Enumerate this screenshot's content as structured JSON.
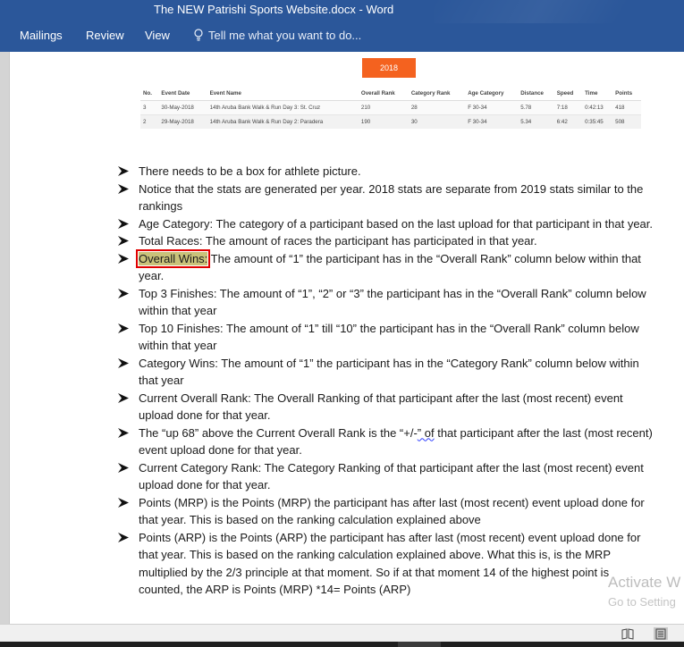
{
  "window": {
    "title": "The NEW Patrishi Sports Website.docx - Word"
  },
  "ribbon": {
    "tabs": [
      "Mailings",
      "Review",
      "View"
    ],
    "tell_me": "Tell me what you want to do..."
  },
  "document": {
    "year_badge": "2018",
    "table": {
      "headers": [
        "No.",
        "Event Date",
        "Event Name",
        "Overall Rank",
        "Category Rank",
        "Age Category",
        "Distance",
        "Speed",
        "Time",
        "Points"
      ],
      "rows": [
        [
          "3",
          "30-May-2018",
          "14th Aruba Bank Walk & Run Day 3: St. Cruz",
          "210",
          "28",
          "F 30-34",
          "5.78",
          "7:18",
          "0:42:13",
          "418"
        ],
        [
          "2",
          "29-May-2018",
          "14th Aruba Bank Walk & Run Day 2: Paradera",
          "190",
          "30",
          "F 30-34",
          "5.34",
          "6:42",
          "0:35:45",
          "508"
        ]
      ]
    },
    "bullets": [
      {
        "text": "There needs to be a box for athlete picture."
      },
      {
        "text": "Notice that the stats are generated per year. 2018 stats are separate from 2019 stats similar to the rankings"
      },
      {
        "text": "Age Category: The category of a participant based on the last upload for that participant in that year."
      },
      {
        "text": "Total Races: The amount of races the participant has participated in that year."
      },
      {
        "label": "Overall Wins:",
        "text": " The amount of “1” the participant has in the “Overall Rank” column below within that year."
      },
      {
        "text": "Top 3 Finishes: The amount of “1”, “2” or “3” the participant has in the “Overall Rank” column below within that year"
      },
      {
        "text": "Top 10 Finishes: The amount of “1” till “10” the participant has in the “Overall Rank” column below within that year"
      },
      {
        "text": "Category Wins: The amount of “1” the participant has in the “Category Rank” column below within that year"
      },
      {
        "text": "Current Overall Rank: The Overall Ranking of that participant after the last (most recent) event upload done for that year."
      },
      {
        "before": "The “up 68” above the Current Overall Rank is the “+/-",
        "wavy": "” of",
        "after": " that participant after the last (most recent) event upload done for that year."
      },
      {
        "text": "Current Category Rank: The Category Ranking of that participant after the last (most recent) event upload done for that year."
      },
      {
        "text": "Points (MRP) is the Points (MRP) the participant has after last (most recent) event upload done for that year. This is based on the ranking calculation explained above"
      },
      {
        "text": "Points (ARP) is the Points (ARP) the participant has after last (most recent) event upload done for that year. This is based on the ranking calculation explained above. What this is, is the MRP multiplied by the 2/3 principle at that moment. So if at that moment 14 of the highest point is counted, the ARP is Points (MRP) *14= Points (ARP)"
      }
    ]
  },
  "watermark": {
    "line1": "Activate W",
    "line2": "Go to Setting"
  },
  "colors": {
    "ribbon": "#2b579a",
    "badge": "#f4621f",
    "highlight": "#c9c27a",
    "box": "#e00000"
  }
}
